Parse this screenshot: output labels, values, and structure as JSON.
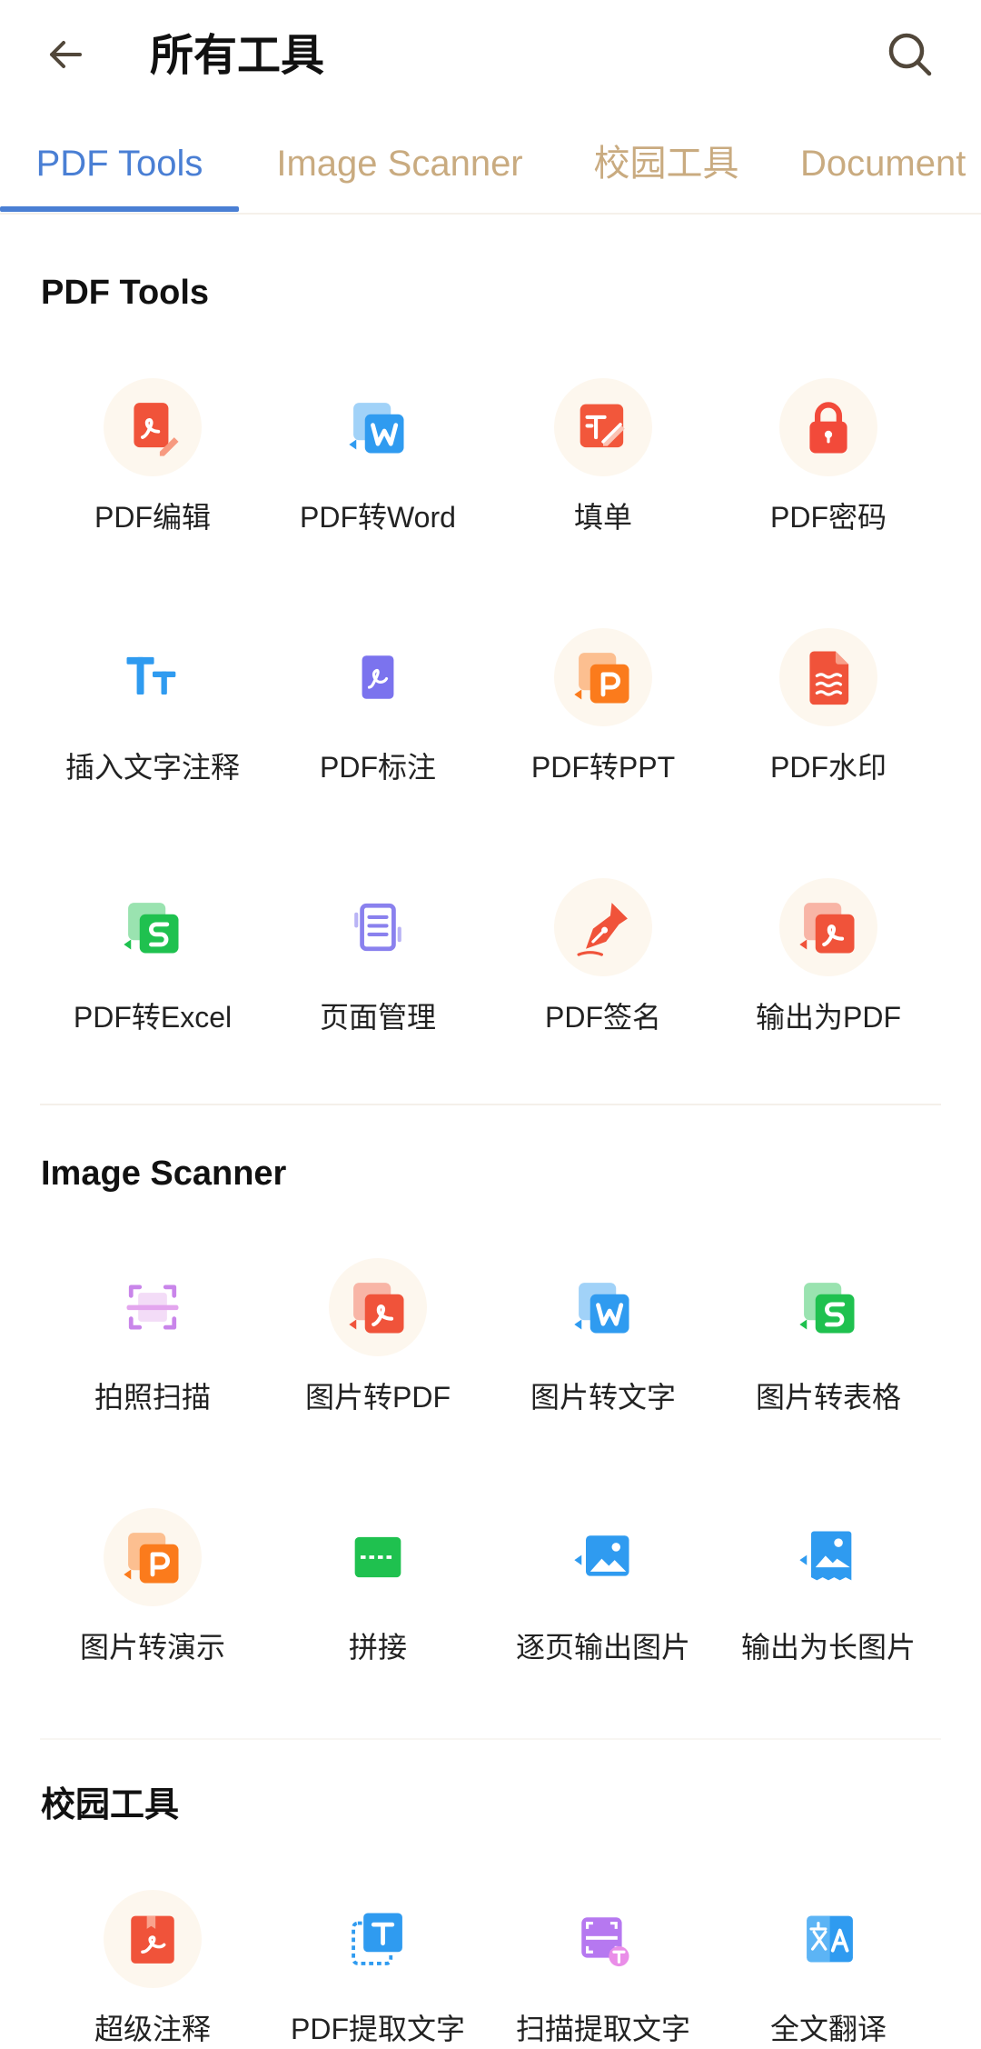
{
  "header": {
    "title": "所有工具",
    "back_icon": "arrow-left-icon",
    "search_icon": "search-icon"
  },
  "tabs": [
    {
      "label": "PDF Tools",
      "active": true
    },
    {
      "label": "Image Scanner",
      "active": false
    },
    {
      "label": "校园工具",
      "active": false
    },
    {
      "label": "Document",
      "active": false
    }
  ],
  "sections": [
    {
      "title": "PDF Tools",
      "tools": [
        {
          "label": "PDF编辑",
          "icon": "pdf-edit-icon"
        },
        {
          "label": "PDF转Word",
          "icon": "pdf-to-word-icon"
        },
        {
          "label": "填单",
          "icon": "form-fill-icon"
        },
        {
          "label": "PDF密码",
          "icon": "lock-icon"
        },
        {
          "label": "插入文字注释",
          "icon": "text-annotation-icon"
        },
        {
          "label": "PDF标注",
          "icon": "pdf-markup-icon"
        },
        {
          "label": "PDF转PPT",
          "icon": "pdf-to-ppt-icon"
        },
        {
          "label": "PDF水印",
          "icon": "watermark-icon"
        },
        {
          "label": "PDF转Excel",
          "icon": "pdf-to-excel-icon"
        },
        {
          "label": "页面管理",
          "icon": "page-manage-icon"
        },
        {
          "label": "PDF签名",
          "icon": "signature-pen-icon"
        },
        {
          "label": "输出为PDF",
          "icon": "export-pdf-icon"
        }
      ]
    },
    {
      "title": "Image Scanner",
      "tools": [
        {
          "label": "拍照扫描",
          "icon": "photo-scan-icon"
        },
        {
          "label": "图片转PDF",
          "icon": "image-to-pdf-icon"
        },
        {
          "label": "图片转文字",
          "icon": "image-to-text-icon"
        },
        {
          "label": "图片转表格",
          "icon": "image-to-table-icon"
        },
        {
          "label": "图片转演示",
          "icon": "image-to-slides-icon"
        },
        {
          "label": "拼接",
          "icon": "stitch-icon"
        },
        {
          "label": "逐页输出图片",
          "icon": "page-export-image-icon"
        },
        {
          "label": "输出为长图片",
          "icon": "long-image-icon"
        }
      ]
    },
    {
      "title": "校园工具",
      "tools": [
        {
          "label": "超级注释",
          "icon": "super-annotation-icon"
        },
        {
          "label": "PDF提取文字",
          "icon": "pdf-extract-text-icon"
        },
        {
          "label": "扫描提取文字",
          "icon": "scan-extract-text-icon"
        },
        {
          "label": "全文翻译",
          "icon": "translate-icon"
        }
      ]
    }
  ],
  "colors": {
    "tab_active": "#4a7fd4",
    "tab_inactive": "#c9ab80",
    "pdf_red": "#f0533a",
    "word_blue": "#2f9bf0",
    "excel_green": "#1fc14f",
    "ppt_orange": "#fb7b1c",
    "markup_purple": "#7b73ee"
  }
}
